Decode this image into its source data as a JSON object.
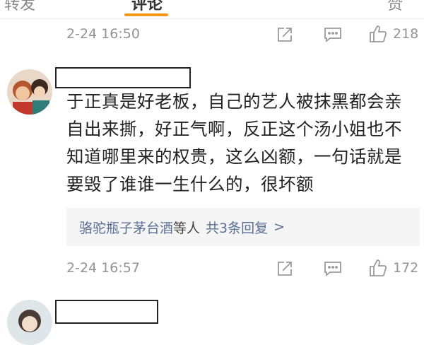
{
  "tabs": {
    "items": [
      {
        "label": "转发"
      },
      {
        "label": "评论"
      },
      {
        "label": "赞"
      }
    ]
  },
  "comments": [
    {
      "timestamp": "2-24 16:50",
      "likes": "218",
      "icons": [
        "share-icon",
        "comment-icon",
        "like-icon"
      ]
    },
    {
      "username_redacted": true,
      "text_lines": [
        "于正真是好老板，自己的艺人被抹黑都会亲",
        "自出来撕，好正气啊，反正这个汤小姐也不",
        "知道哪里来的权贵，这么凶额，一句话就是",
        "要毁了谁谁一生什么的，很坏额"
      ],
      "replies": {
        "users": "骆驼瓶子茅台酒",
        "suffix": "等人",
        "count_label": "共3条回复",
        "chevron": ">"
      },
      "timestamp": "2-24 16:57",
      "likes": "172",
      "icons": [
        "share-icon",
        "comment-icon",
        "like-icon"
      ]
    },
    {
      "username_redacted": true
    }
  ],
  "colors": {
    "accent": "#f79b1c",
    "link": "#5a6f97",
    "meta": "#939393",
    "text": "#222222",
    "reply_bg": "#f5f5f5"
  }
}
